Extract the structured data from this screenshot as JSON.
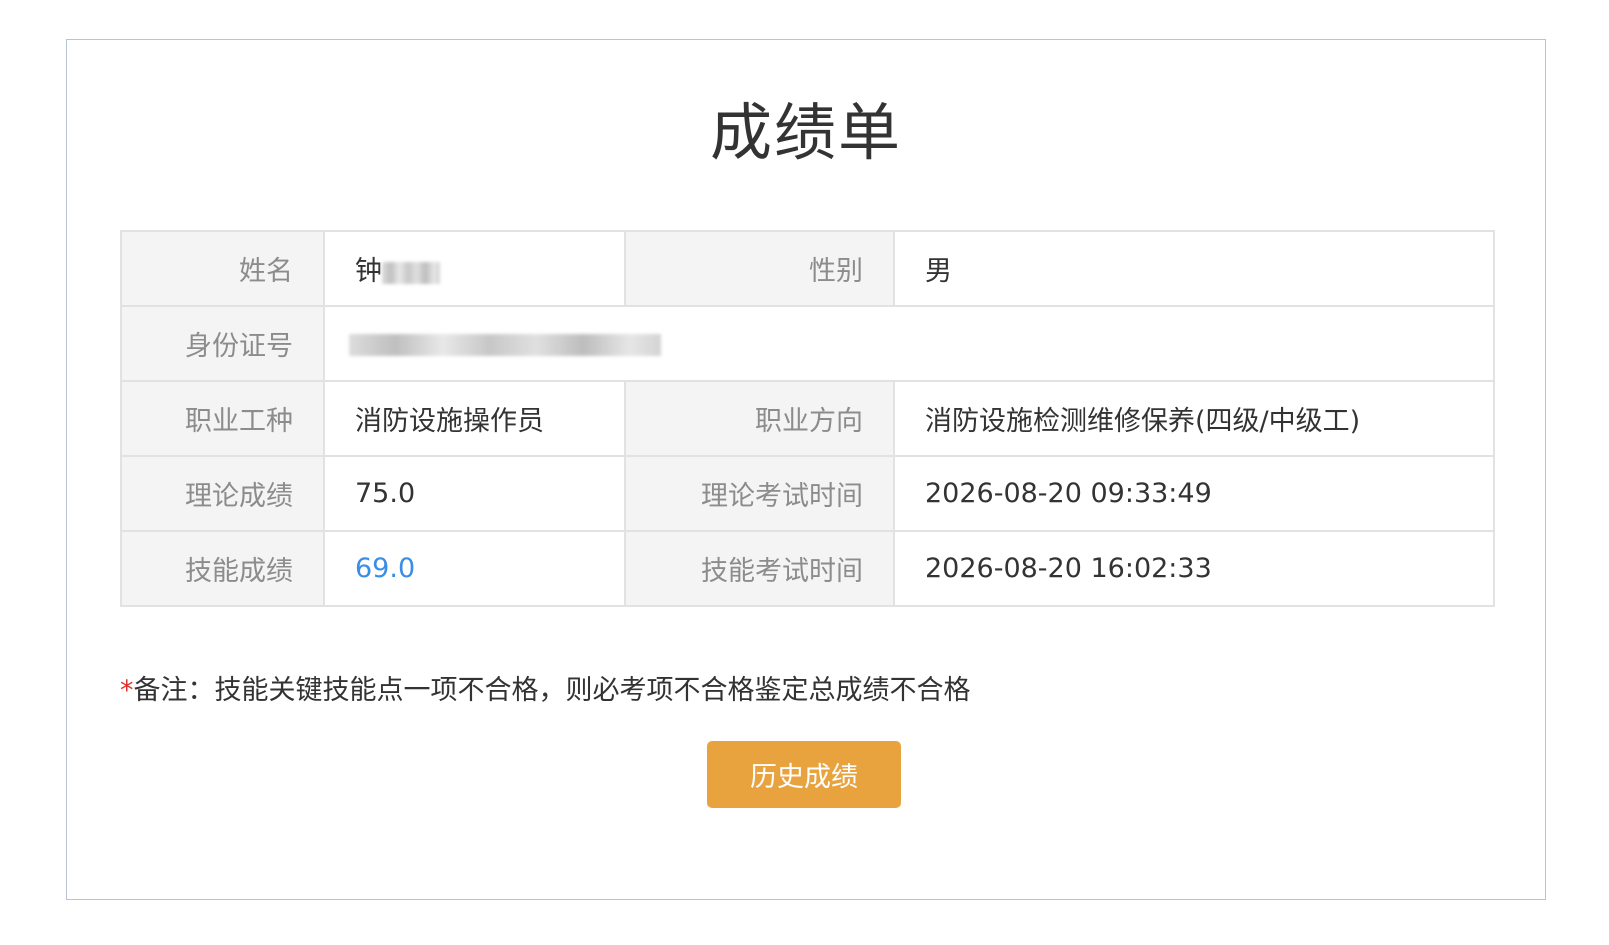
{
  "title": "成绩单",
  "rows": {
    "name": {
      "label": "姓名",
      "value": "钟"
    },
    "gender": {
      "label": "性别",
      "value": "男"
    },
    "id_number": {
      "label": "身份证号"
    },
    "occupation": {
      "label": "职业工种",
      "value": "消防设施操作员"
    },
    "direction": {
      "label": "职业方向",
      "value": "消防设施检测维修保养(四级/中级工)"
    },
    "theory_score": {
      "label": "理论成绩",
      "value": "75.0"
    },
    "theory_time": {
      "label": "理论考试时间",
      "value": "2026-08-20 09:33:49"
    },
    "skill_score": {
      "label": "技能成绩",
      "value": "69.0"
    },
    "skill_time": {
      "label": "技能考试时间",
      "value": "2026-08-20 16:02:33"
    }
  },
  "note": {
    "star": "*",
    "text": "备注：技能关键技能点一项不合格，则必考项不合格鉴定总成绩不合格"
  },
  "history_button": "历史成绩",
  "colors": {
    "button_bg": "#e8a33e",
    "link": "#3a8ee6",
    "label_bg": "#f4f4f4",
    "required_star": "#e0302b"
  }
}
